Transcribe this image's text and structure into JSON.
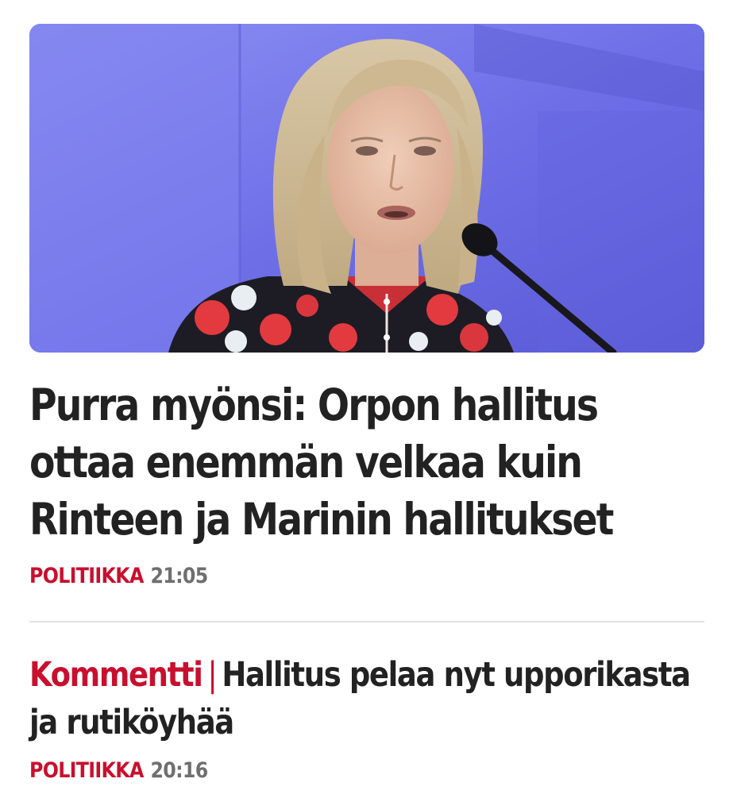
{
  "articles": [
    {
      "headline": "Purra myönsi: Orpon hallitus ottaa enemmän velkaa kuin Rinteen ja Marinin hallitukset",
      "category": "POLITIIKKA",
      "time": "21:05"
    },
    {
      "kicker": "Kommentti",
      "separator": "|",
      "headline": "Hallitus pelaa nyt upporikasta ja rutiköyhää",
      "category": "POLITIIKKA",
      "time": "20:16"
    }
  ],
  "colors": {
    "accent": "#c8102e",
    "headline": "#222222",
    "meta_time": "#6f6f6f",
    "divider": "#e1e1e1",
    "hero_background": "#6d6ee6"
  }
}
